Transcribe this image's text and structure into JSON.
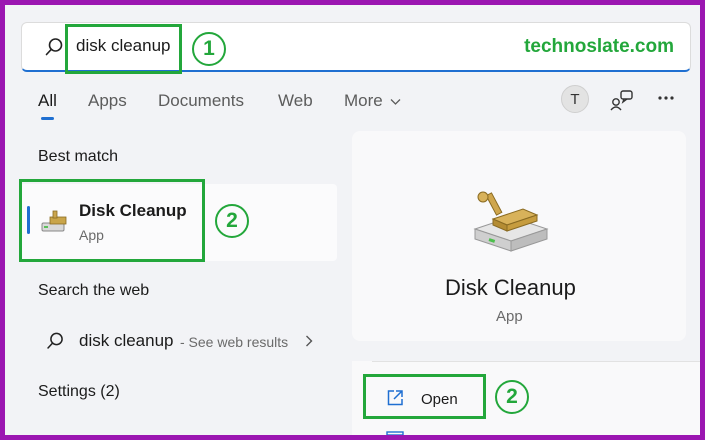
{
  "search": {
    "query": "disk cleanup"
  },
  "brand": "technoslate.com",
  "callouts": {
    "one": "1",
    "two": "2"
  },
  "tabs": [
    {
      "label": "All",
      "active": true
    },
    {
      "label": "Apps"
    },
    {
      "label": "Documents"
    },
    {
      "label": "Web"
    },
    {
      "label": "More"
    }
  ],
  "header_actions": {
    "avatar_letter": "T"
  },
  "left": {
    "best_match_heading": "Best match",
    "best_match": {
      "title": "Disk Cleanup",
      "subtitle": "App"
    },
    "search_web_heading": "Search the web",
    "web_result": {
      "query": "disk cleanup",
      "suffix": "- See web results"
    },
    "settings_heading": "Settings (2)"
  },
  "right": {
    "app_title": "Disk Cleanup",
    "app_subtitle": "App",
    "actions": [
      {
        "label": "Open"
      }
    ]
  },
  "colors": {
    "frame": "#9b16b1",
    "highlight": "#23a73b",
    "accent": "#1f6fd1"
  }
}
